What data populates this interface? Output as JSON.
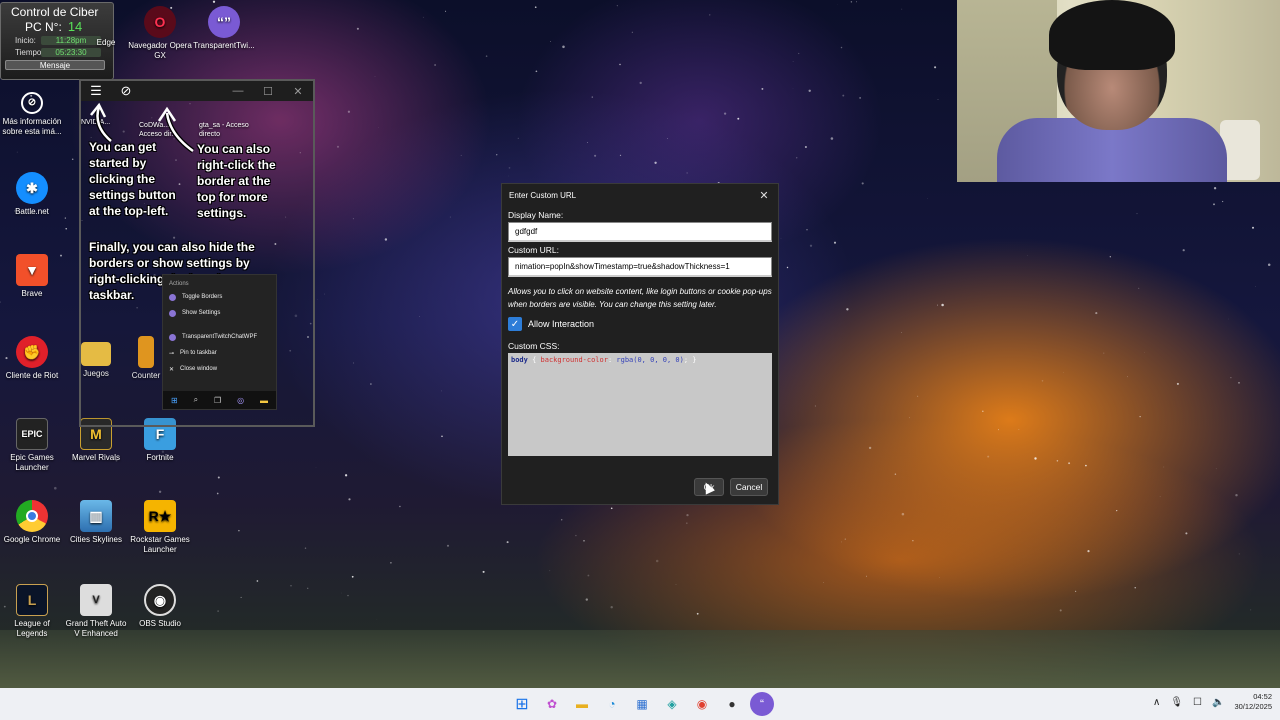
{
  "cyber_panel": {
    "title": "Control de Ciber",
    "pc_label": "PC N°:",
    "pc_number": "14",
    "start_label": "Inicio:",
    "start_value": "11:28pm",
    "time_label": "Tiempo:",
    "time_value": "05:23:30",
    "message_button": "Mensaje"
  },
  "desktop_icons": [
    {
      "label": "Edge",
      "icon": "edge-icon"
    },
    {
      "label": "Navegador Opera GX",
      "icon": "opera-gx-icon"
    },
    {
      "label": "TransparentTwi...",
      "icon": "transparent-twitch-icon"
    },
    {
      "label": "Más información sobre esta imá...",
      "icon": "info-icon"
    },
    {
      "label": "Battle.net",
      "icon": "battlenet-icon"
    },
    {
      "label": "Brave",
      "icon": "brave-icon"
    },
    {
      "label": "Cliente de Riot",
      "icon": "riot-icon"
    },
    {
      "label": "Juegos",
      "icon": "folder-icon"
    },
    {
      "label": "Counter",
      "icon": "counter-icon"
    },
    {
      "label": "Epic Games Launcher",
      "icon": "epic-icon"
    },
    {
      "label": "Marvel Rivals",
      "icon": "marvel-rivals-icon"
    },
    {
      "label": "Fortnite",
      "icon": "fortnite-icon"
    },
    {
      "label": "Google Chrome",
      "icon": "chrome-icon"
    },
    {
      "label": "Cities Skylines",
      "icon": "cities-skylines-icon"
    },
    {
      "label": "Rockstar Games Launcher",
      "icon": "rockstar-icon"
    },
    {
      "label": "League of Legends",
      "icon": "lol-icon"
    },
    {
      "label": "Grand Theft Auto V Enhanced",
      "icon": "gta-icon"
    },
    {
      "label": "OBS Studio",
      "icon": "obs-icon"
    }
  ],
  "tutorial": {
    "text1": "You can get started by clicking the settings button at the top-left.",
    "text2": "You can also right-click the border at the top for more settings.",
    "text3": "Finally, you can also hide the borders or show settings by right-clicking the icon in your taskbar.",
    "behind_labels": [
      "NVIDIA...",
      "CoDWa... Acceso dir...",
      "gta_sa - Acceso directo"
    ],
    "menu": {
      "header": "Actions",
      "toggle_borders": "Toggle Borders",
      "show_settings": "Show Settings",
      "app_name": "TransparentTwitchChatWPF",
      "pin": "Pin to taskbar",
      "close": "Close window"
    }
  },
  "dialog": {
    "title": "Enter Custom URL",
    "display_name_label": "Display Name:",
    "display_name_value": "gdfgdf",
    "custom_url_label": "Custom URL:",
    "custom_url_value": "nimation=popIn&showTimestamp=true&shadowThickness=1",
    "note": "Allows you to click on website content, like login buttons or cookie pop-ups when borders are visible. You can change this setting later.",
    "allow_interaction_label": "Allow Interaction",
    "allow_interaction_checked": true,
    "custom_css_label": "Custom CSS:",
    "css_selector": "body",
    "css_open": " { ",
    "css_prop": "background-color",
    "css_colon": ": ",
    "css_value": "rgba(0, 0, 0, 0)",
    "css_close": "; }",
    "ok_label": "Ok",
    "cancel_label": "Cancel"
  },
  "taskbar": {
    "time": "04:52",
    "date": "30/12/2025"
  }
}
